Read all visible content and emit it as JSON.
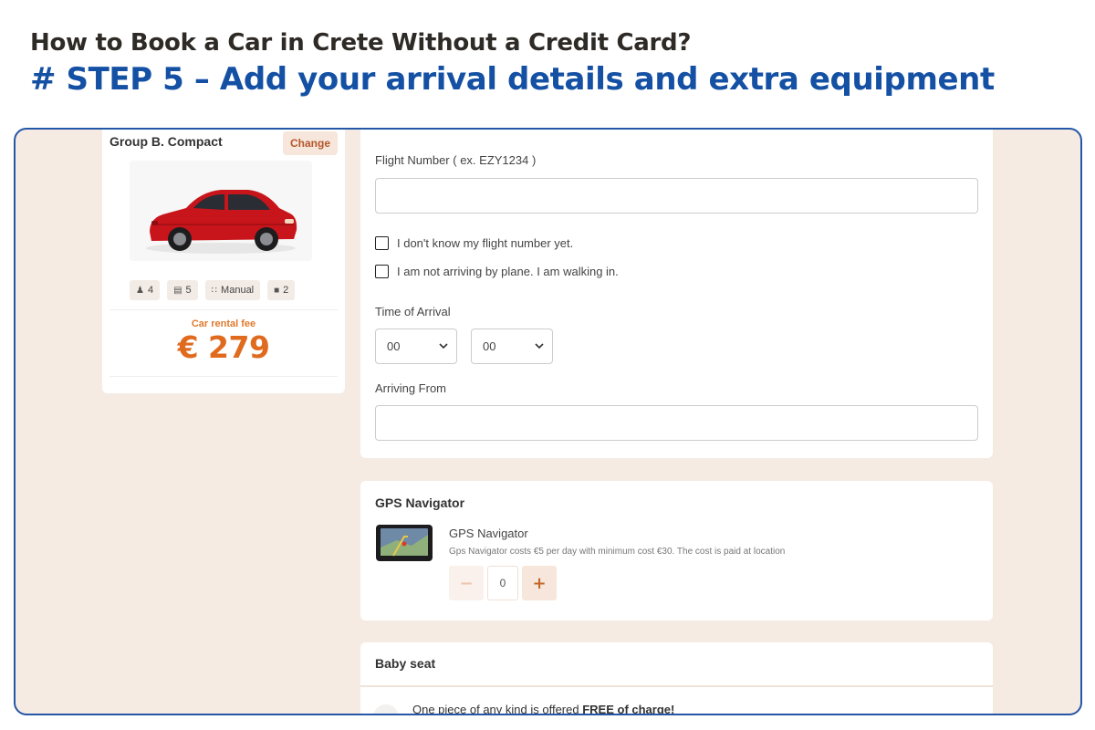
{
  "heading": {
    "title": "How to Book a Car in Crete Without a Credit Card?",
    "step": "# STEP 5 – Add your arrival details and extra equipment"
  },
  "car_card": {
    "group": "Group B. Compact",
    "change_label": "Change",
    "specs": {
      "seats": "4",
      "doors": "5",
      "transmission": "Manual",
      "bags": "2"
    },
    "fee_label": "Car rental fee",
    "fee_value": "€ 279"
  },
  "flight_form": {
    "flight_number_label": "Flight Number ( ex. EZY1234 )",
    "flight_number_value": "",
    "unknown_flight_label": "I don't know my flight number yet.",
    "not_by_plane_label": "I am not arriving by plane. I am walking in.",
    "time_label": "Time of Arrival",
    "hour_value": "00",
    "minute_value": "00",
    "arriving_from_label": "Arriving From",
    "arriving_from_value": ""
  },
  "gps": {
    "title": "GPS Navigator",
    "item_name": "GPS Navigator",
    "description": "Gps Navigator costs €5 per day with minimum cost €30. The cost is paid at location",
    "minus": "−",
    "quantity": "0",
    "plus": "+"
  },
  "baby_seat": {
    "title": "Baby seat",
    "note_prefix": "One piece of any kind is offered ",
    "note_bold": "FREE of charge!"
  },
  "colors": {
    "step_blue": "#1450a3",
    "frame_border": "#2557a7",
    "background_beige": "#f6ebe3",
    "accent_orange": "#e06b1f"
  }
}
